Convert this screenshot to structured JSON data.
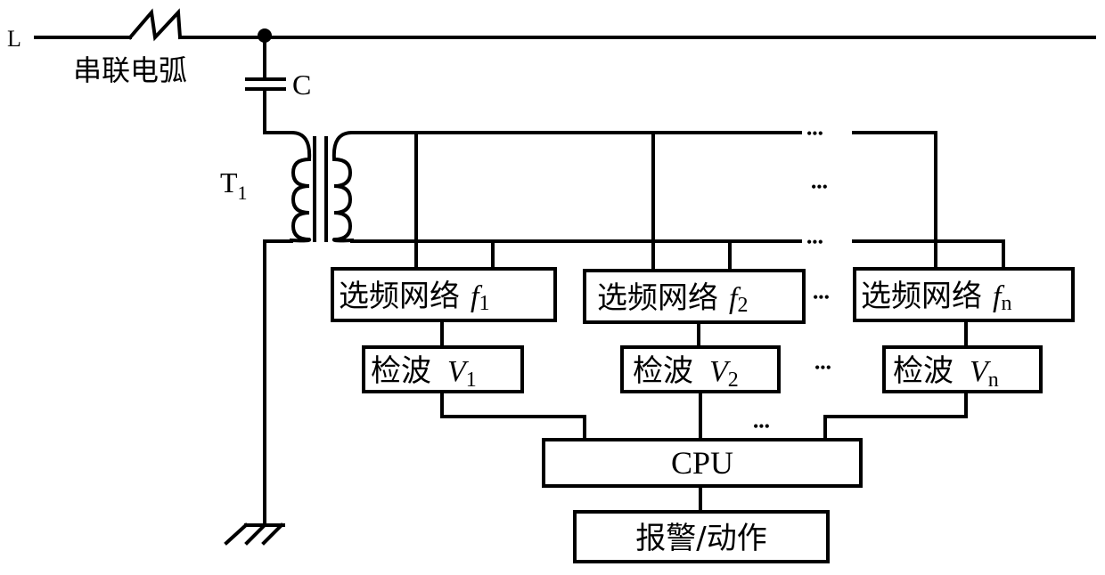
{
  "line_label": "L",
  "arc_label": "串联电弧",
  "capacitor_label": "C",
  "transformer_label": "T",
  "transformer_subscript": "1",
  "ellipsis": "•••",
  "filters": [
    {
      "text": "选频网络",
      "var": "f",
      "sub": "1"
    },
    {
      "text": "选频网络",
      "var": "f",
      "sub": "2"
    },
    {
      "text": "选频网络",
      "var": "f",
      "sub": "n"
    }
  ],
  "detectors": [
    {
      "text": "检波",
      "var": "V",
      "sub": "1"
    },
    {
      "text": "检波",
      "var": "V",
      "sub": "2"
    },
    {
      "text": "检波",
      "var": "V",
      "sub": "n"
    }
  ],
  "cpu_label": "CPU",
  "alarm_label": "报警/动作",
  "colors": {
    "stroke": "#000000",
    "background": "#ffffff"
  }
}
